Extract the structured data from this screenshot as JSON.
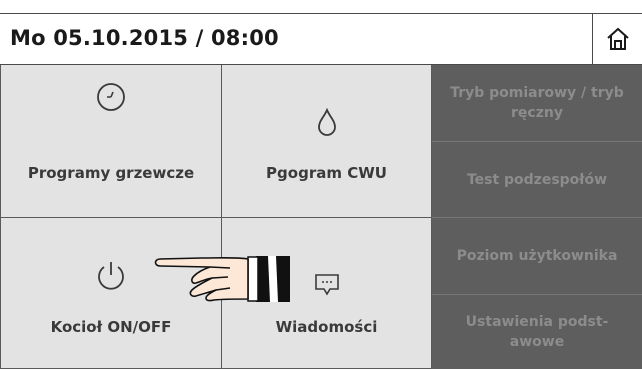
{
  "header": {
    "datetime": "Mo 05.10.2015 / 08:00",
    "home_icon": "home-icon"
  },
  "tiles": [
    {
      "label": "Programy grzewcze",
      "icon": "clock-icon"
    },
    {
      "label": "Pgogram CWU",
      "icon": "water-drop-icon"
    },
    {
      "label": "Kocioł ON/OFF",
      "icon": "power-icon"
    },
    {
      "label": "Wiadomości",
      "icon": "message-icon"
    }
  ],
  "side_menu": [
    {
      "label_line1": "Tryb pomiarowy / tryb",
      "label_line2": "ręczny"
    },
    {
      "label_line1": "Test podzespołów",
      "label_line2": ""
    },
    {
      "label_line1": "Poziom użytkownika",
      "label_line2": ""
    },
    {
      "label_line1": "Ustawienia podst-",
      "label_line2": "awowe"
    }
  ],
  "colors": {
    "tile_bg": "#e3e3e3",
    "side_bg": "#5e5e5e",
    "side_text": "#8c8c8c",
    "text_dark": "#3a3a3a"
  }
}
